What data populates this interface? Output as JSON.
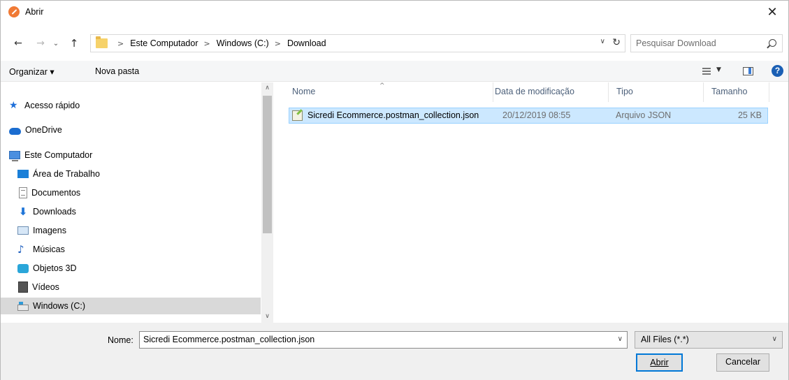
{
  "window": {
    "title": "Abrir",
    "close_glyph": "✕"
  },
  "navigation": {
    "back_glyph": "←",
    "forward_glyph": "→",
    "recent_glyph": "⌄",
    "up_glyph": "↑"
  },
  "address_bar": {
    "separator": ">",
    "crumbs": [
      "Este Computador",
      "Windows (C:)",
      "Download"
    ],
    "dropdown_glyph": "∨",
    "refresh_glyph": "↻"
  },
  "search": {
    "placeholder": "Pesquisar Download"
  },
  "toolbar": {
    "organize_label": "Organizar ▾",
    "new_folder_label": "Nova pasta",
    "view_dropdown_glyph": "▼",
    "help_glyph": "?"
  },
  "sidebar": {
    "items": [
      {
        "label": "Acesso rápido",
        "icon": "star-icon"
      },
      {
        "label": "OneDrive",
        "icon": "cloud-icon"
      },
      {
        "label": "Este Computador",
        "icon": "computer-icon"
      },
      {
        "label": "Área de Trabalho",
        "icon": "desktop-icon"
      },
      {
        "label": "Documentos",
        "icon": "document-icon"
      },
      {
        "label": "Downloads",
        "icon": "download-icon"
      },
      {
        "label": "Imagens",
        "icon": "pictures-icon"
      },
      {
        "label": "Músicas",
        "icon": "music-icon"
      },
      {
        "label": "Objetos 3D",
        "icon": "3d-objects-icon"
      },
      {
        "label": "Vídeos",
        "icon": "videos-icon"
      },
      {
        "label": "Windows (C:)",
        "icon": "drive-icon",
        "selected": true
      }
    ],
    "scroll_up_glyph": "∧",
    "scroll_down_glyph": "∨"
  },
  "file_list": {
    "sort_glyph": "^",
    "columns": [
      "Nome",
      "Data de modificação",
      "Tipo",
      "Tamanho"
    ],
    "rows": [
      {
        "name": "Sicredi Ecommerce.postman_collection.json",
        "modified": "20/12/2019 08:55",
        "type": "Arquivo JSON",
        "size": "25 KB",
        "selected": true
      }
    ]
  },
  "bottom": {
    "name_label": "Nome:",
    "name_value": "Sicredi Ecommerce.postman_collection.json",
    "dropdown_glyph": "∨",
    "file_type": "All Files (*.*)",
    "open_button": "Abrir",
    "cancel_button": "Cancelar"
  },
  "colors": {
    "selection_bg": "#cce8ff",
    "selection_border": "#99d1ff",
    "primary_border": "#0078d7",
    "sidebar_selected": "#d9d9d9"
  }
}
